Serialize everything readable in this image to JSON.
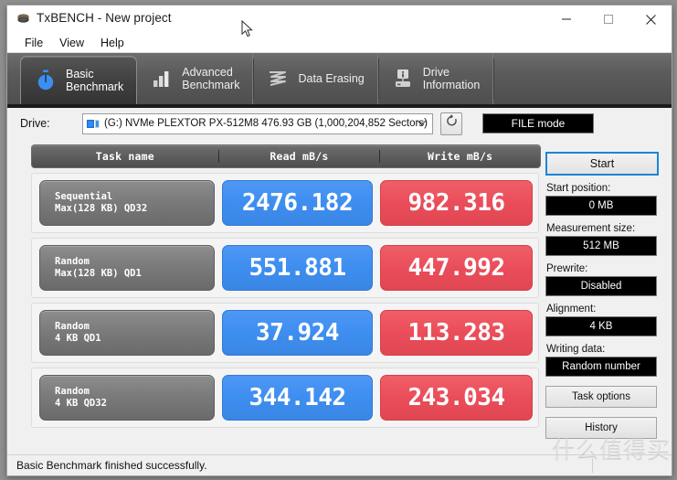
{
  "window": {
    "title": "TxBENCH - New project",
    "app_icon": "drive-icon",
    "controls": {
      "minimize": "minimize-icon",
      "maximize": "maximize-icon",
      "close": "close-icon"
    }
  },
  "menu": {
    "items": [
      "File",
      "View",
      "Help"
    ]
  },
  "tabs": [
    {
      "label": "Basic\nBenchmark",
      "icon": "stopwatch-icon",
      "active": true
    },
    {
      "label": "Advanced\nBenchmark",
      "icon": "bar-chart-icon",
      "active": false
    },
    {
      "label": "Data Erasing",
      "icon": "eraser-icon",
      "active": false
    },
    {
      "label": "Drive\nInformation",
      "icon": "drive-info-icon",
      "active": false
    }
  ],
  "drive": {
    "label": "Drive:",
    "value": "(G:) NVMe PLEXTOR PX-512M8  476.93 GB (1,000,204,852 Sectors)",
    "icon": "disk-icon",
    "dropdown_arrow": "chevron-down-icon",
    "refresh_icon": "refresh-icon"
  },
  "mode_button": "FILE mode",
  "table": {
    "headers": [
      "Task name",
      "Read mB/s",
      "Write mB/s"
    ],
    "rows": [
      {
        "task_line1": "Sequential",
        "task_line2": "Max(128 KB) QD32",
        "read": "2476.182",
        "write": "982.316"
      },
      {
        "task_line1": "Random",
        "task_line2": "Max(128 KB) QD1",
        "read": "551.881",
        "write": "447.992"
      },
      {
        "task_line1": "Random",
        "task_line2": "4 KB QD1",
        "read": "37.924",
        "write": "113.283"
      },
      {
        "task_line1": "Random",
        "task_line2": "4 KB QD32",
        "read": "344.142",
        "write": "243.034"
      }
    ]
  },
  "panel": {
    "start_button": "Start",
    "fields": [
      {
        "label": "Start position:",
        "value": "0 MB"
      },
      {
        "label": "Measurement size:",
        "value": "512 MB"
      },
      {
        "label": "Prewrite:",
        "value": "Disabled"
      },
      {
        "label": "Alignment:",
        "value": "4 KB"
      },
      {
        "label": "Writing data:",
        "value": "Random number"
      }
    ],
    "buttons": [
      "Task options",
      "History"
    ]
  },
  "status": {
    "message": "Basic Benchmark finished successfully."
  },
  "watermark": {
    "text": "什么值得买"
  },
  "colors": {
    "read_cell": "#3d8ef0",
    "write_cell": "#ea4d5a",
    "accent_focus": "#1b86d8",
    "tabstrip": "#5b5b5b",
    "field_bg": "#000000"
  }
}
